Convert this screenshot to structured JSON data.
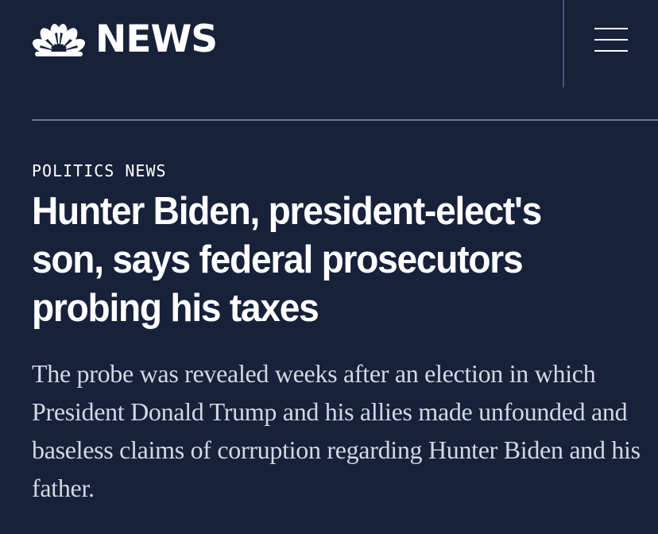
{
  "header": {
    "logo_text": "NEWS",
    "menu_icon": "hamburger-menu-icon",
    "logo_icon": "nbc-peacock-icon"
  },
  "article": {
    "section": "POLITICS NEWS",
    "headline": "Hunter Biden, president-elect's son, says federal prosecutors probing his taxes",
    "dek": "The probe was revealed weeks after an election in which President Donald Trump and his allies made unfounded and baseless claims of corruption regarding Hunter Biden and his father."
  },
  "colors": {
    "background": "#17213a",
    "text": "#ffffff",
    "dek_text": "#d4d8e2",
    "rule": "#6f7789"
  }
}
